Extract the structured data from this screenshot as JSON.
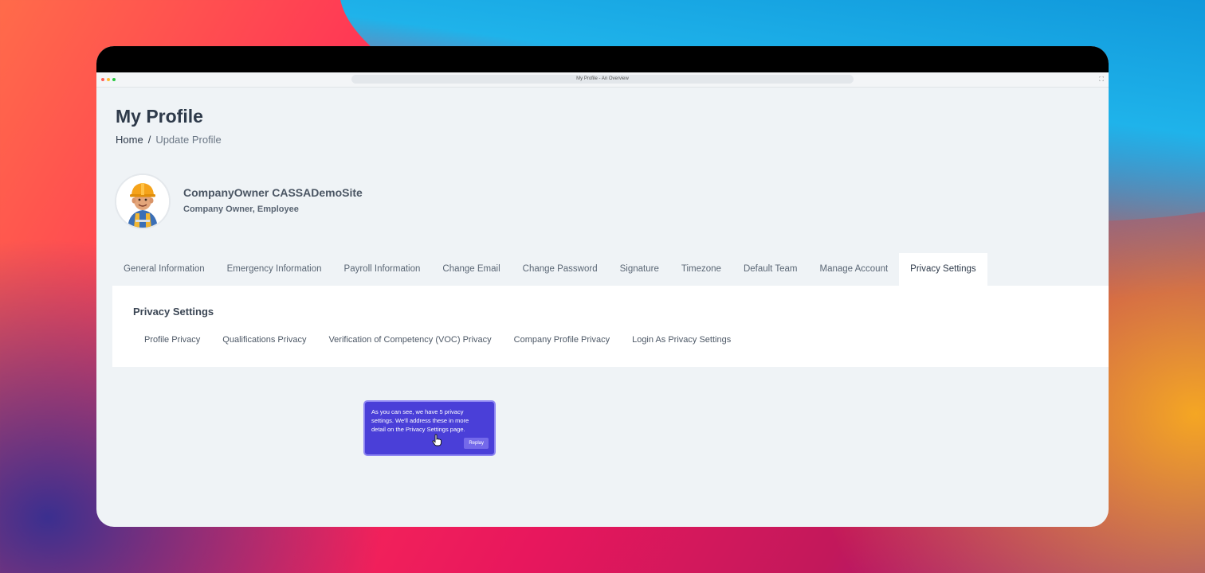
{
  "browser": {
    "address_text": "My Profile - An Overview",
    "expand_icon": "expand-icon"
  },
  "page": {
    "title": "My Profile",
    "breadcrumb": {
      "home": "Home",
      "separator": "/",
      "current": "Update Profile"
    }
  },
  "user": {
    "name": "CompanyOwner CASSADemoSite",
    "roles": "Company Owner, Employee",
    "avatar_icon": "worker-avatar-icon"
  },
  "tabs": [
    {
      "label": "General Information"
    },
    {
      "label": "Emergency Information"
    },
    {
      "label": "Payroll Information"
    },
    {
      "label": "Change Email"
    },
    {
      "label": "Change Password"
    },
    {
      "label": "Signature"
    },
    {
      "label": "Timezone"
    },
    {
      "label": "Default Team"
    },
    {
      "label": "Manage Account"
    },
    {
      "label": "Privacy Settings",
      "active": true
    }
  ],
  "privacy": {
    "title": "Privacy Settings",
    "subtabs": [
      {
        "label": "Profile Privacy"
      },
      {
        "label": "Qualifications Privacy"
      },
      {
        "label": "Verification of Competency (VOC) Privacy"
      },
      {
        "label": "Company Profile Privacy"
      },
      {
        "label": "Login As Privacy Settings"
      }
    ]
  },
  "tooltip": {
    "text": "As you can see, we have 5 privacy settings. We'll address these in more detail on the Privacy Settings page.",
    "replay_label": "Replay"
  },
  "colors": {
    "tooltip_bg": "#4a3fd8",
    "page_bg": "#eff3f6",
    "title": "#2e3a4a"
  }
}
